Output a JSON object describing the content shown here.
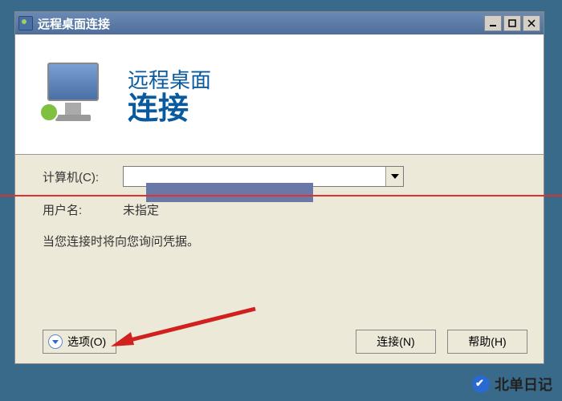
{
  "window": {
    "title": "远程桌面连接"
  },
  "header": {
    "line1": "远程桌面",
    "line2": "连接"
  },
  "form": {
    "computer_label": "计算机(C):",
    "computer_value": "",
    "username_label": "用户名:",
    "username_value": "未指定",
    "info": "当您连接时将向您询问凭据。"
  },
  "buttons": {
    "options": "选项(O)",
    "connect": "连接(N)",
    "help": "帮助(H)"
  },
  "watermark": "北单日记"
}
